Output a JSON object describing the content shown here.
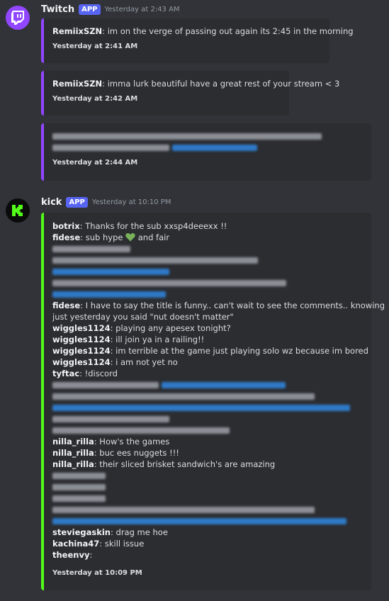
{
  "twitch": {
    "author": "Twitch",
    "badge": "APP",
    "timestamp": "Yesterday at 2:43 AM",
    "embeds": [
      {
        "user": "RemiixSZN",
        "text": ": im on the verge of passing out again its 2:45 in the morning",
        "footer": "Yesterday at 2:41 AM"
      },
      {
        "user": "RemiixSZN",
        "text": ": imma lurk beautiful have a great rest of your stream < 3",
        "footer": "Yesterday at 2:42 AM"
      },
      {
        "footer": "Yesterday at 2:44 AM"
      }
    ]
  },
  "kick": {
    "author": "kick",
    "badge": "APP",
    "timestamp": "Yesterday at 10:10 PM",
    "footer": "Yesterday at 10:09 PM",
    "lines": [
      {
        "user": "botrix",
        "text": ": Thanks for the sub xxsp4deeexx !!"
      },
      {
        "user": "fidese",
        "text": ": sub hype",
        "after": " and fair"
      },
      {
        "user": "fidese",
        "text": ": I have to say the title is funny.. can't wait to see the comments.. knowing"
      },
      {
        "text": "just yesterday you said \"nut doesn't matter\""
      },
      {
        "user": "wiggles1124",
        "text": ": playing any apesex tonight?"
      },
      {
        "user": "wiggles1124",
        "text": ": ill join ya in a railing!!"
      },
      {
        "user": "wiggles1124",
        "text": ": im terrible at the game just playing solo wz because im bored"
      },
      {
        "user": "wiggles1124",
        "text": ": i am not yet no"
      },
      {
        "user": "tyftac",
        "text": ": !discord"
      },
      {
        "user": "nilla_rilla",
        "text": ": How's the games"
      },
      {
        "user": "nilla_rilla",
        "text": ": buc ees nuggets !!!"
      },
      {
        "user": "nilla_rilla",
        "text": ": their sliced brisket sandwich's are amazing"
      },
      {
        "user": "steviegaskin",
        "text": ": drag me hoe"
      },
      {
        "user": "kachina47",
        "text": ": skill issue"
      },
      {
        "user": "theenvy",
        "text": ":"
      }
    ]
  },
  "icons": {
    "twitch": "twitch-logo-icon",
    "kick": "kick-logo-icon",
    "heart": "green-heart-icon"
  },
  "colors": {
    "twitch_accent": "#9146ff",
    "kick_accent": "#53fc18",
    "badge": "#5865f2"
  }
}
